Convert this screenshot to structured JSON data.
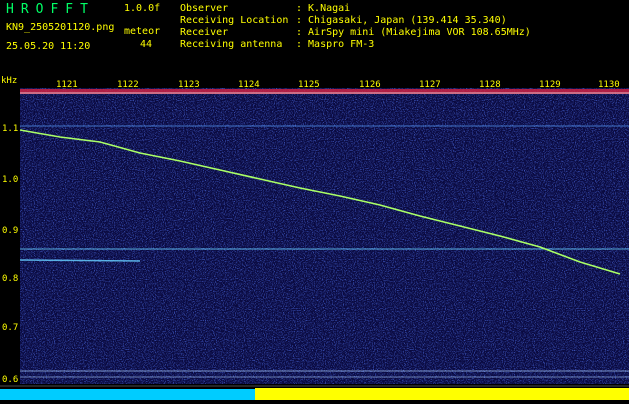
{
  "header": {
    "brand": "HROFFT",
    "version": "1.0.0f",
    "filename": "KN9_2505201120.png",
    "mode": "meteor",
    "number": "44",
    "datetime": "25.05.20 11:20",
    "info": [
      {
        "label": "Observer",
        "value": ": K.Nagai"
      },
      {
        "label": "Receiving Location",
        "value": ": Chigasaki, Japan (139.414 35.340)"
      },
      {
        "label": "Receiver",
        "value": ": AirSpy mini (Miakejima VOR 108.65MHz)"
      },
      {
        "label": "Receiving antenna",
        "value": ": Maspro FM-3"
      }
    ]
  },
  "waterfall": {
    "y_unit": "kHz",
    "y_ticks": [
      "1.1",
      "1.0",
      "0.9",
      "0.8",
      "0.7",
      "0.6"
    ],
    "x_ticks": [
      "1121",
      "1122",
      "1123",
      "1124",
      "1125",
      "1126",
      "1127",
      "1128",
      "1129",
      "1130"
    ],
    "colors": {
      "trace": "#aaff66",
      "carrier": "#66ccff",
      "noise_bg": "#0a0a40",
      "amplitude_cyan": "#00ccff",
      "amplitude_yellow": "#ffff00"
    }
  }
}
